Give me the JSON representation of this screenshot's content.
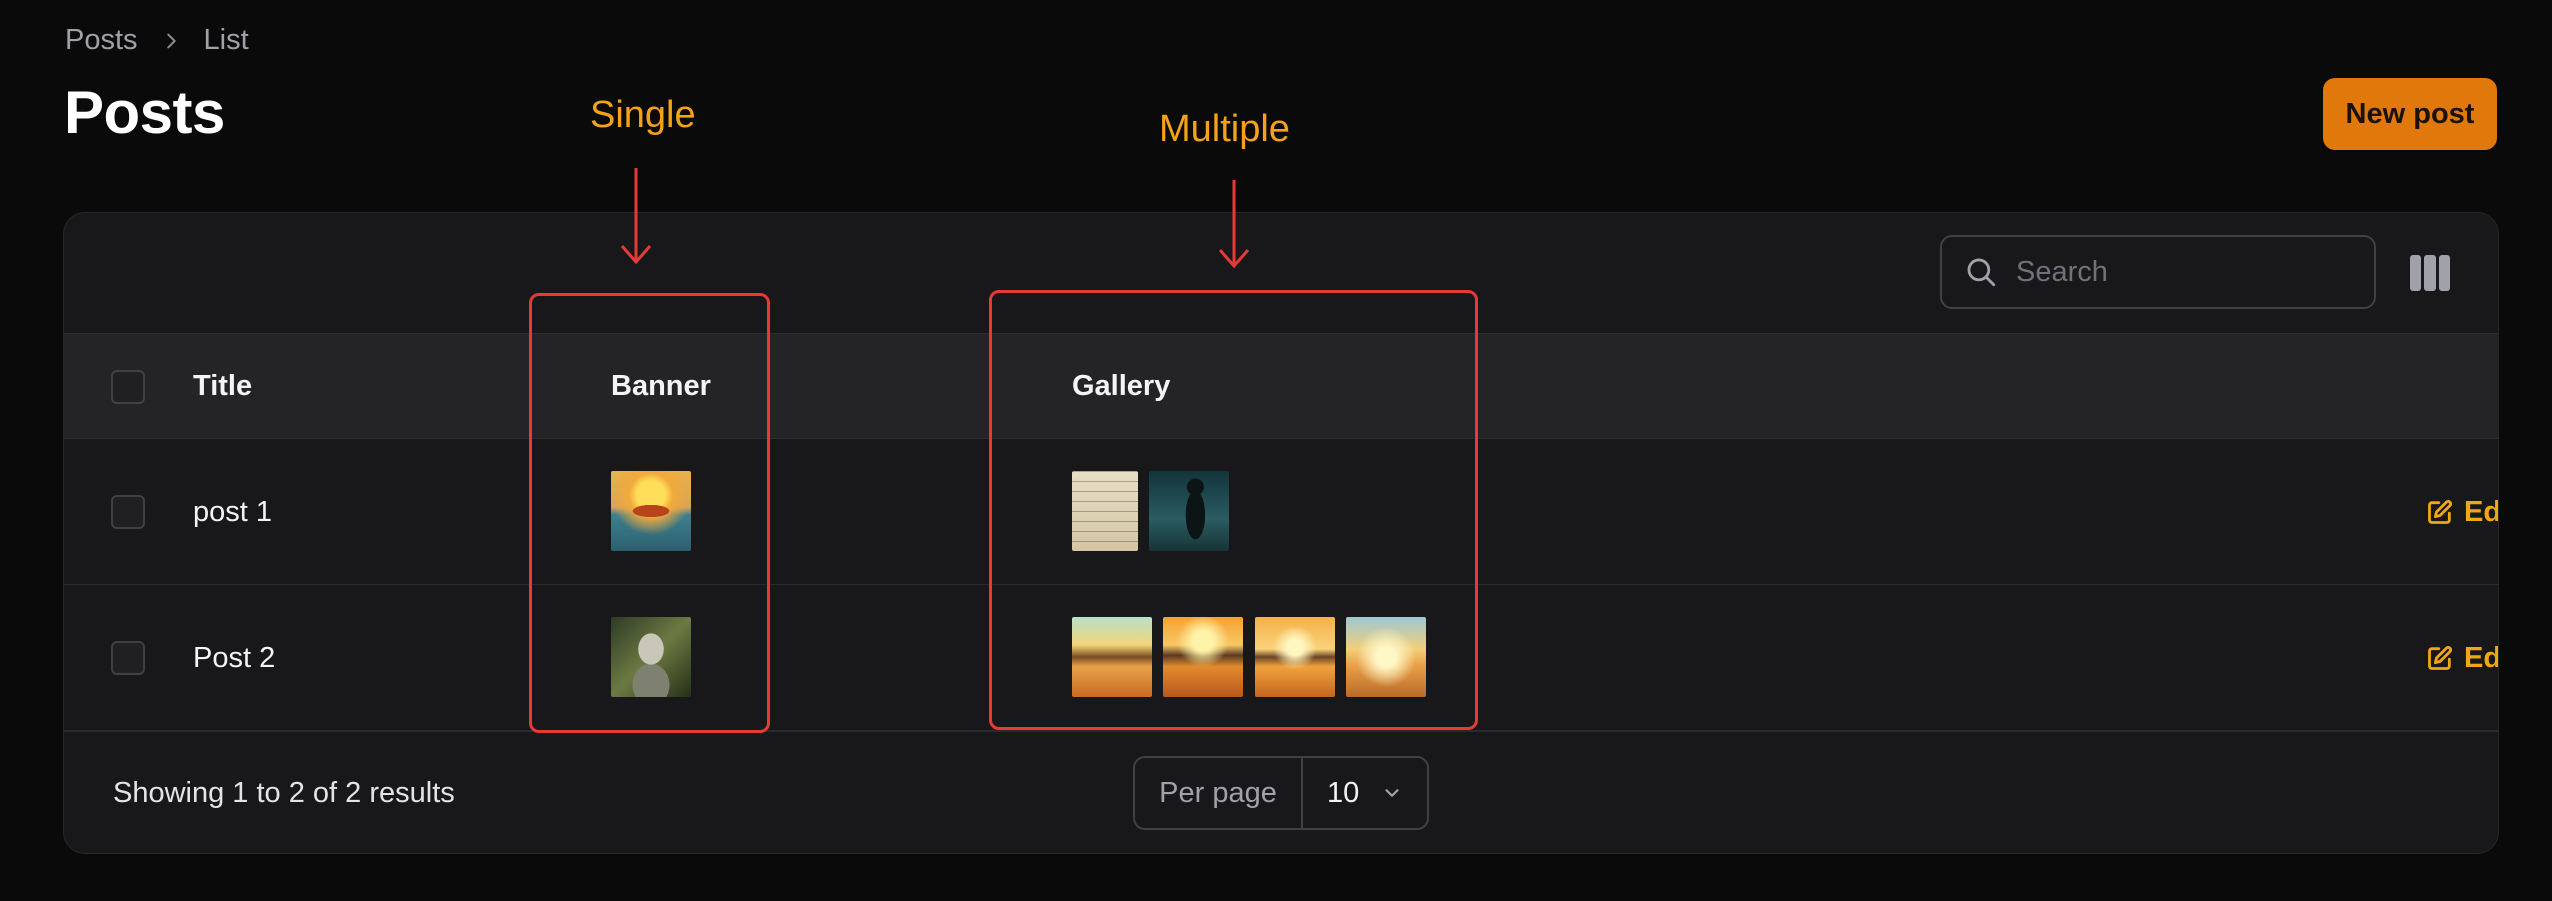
{
  "breadcrumb": {
    "items": [
      "Posts",
      "List"
    ]
  },
  "page": {
    "title": "Posts"
  },
  "actions": {
    "new_post_label": "New post"
  },
  "search": {
    "placeholder": "Search",
    "value": ""
  },
  "table": {
    "columns": [
      "Title",
      "Banner",
      "Gallery"
    ],
    "rows": [
      {
        "title": "post 1",
        "banner": "mushroom-landscape-image",
        "gallery": [
          "sketch-paper-image",
          "girl-silhouette-image"
        ],
        "action_label": "Edit"
      },
      {
        "title": "Post 2",
        "banner": "robot-image",
        "gallery": [
          "sunset-gas-station-image-1",
          "sunset-gas-station-image-2",
          "sunset-gas-station-image-3",
          "sunset-gas-station-image-4"
        ],
        "action_label": "Edit"
      }
    ]
  },
  "footer": {
    "results_text": "Showing 1 to 2 of 2 results",
    "per_page_label": "Per page",
    "per_page_value": "10"
  },
  "annotations": {
    "single_label": "Single",
    "multiple_label": "Multiple",
    "color": "#e53a36",
    "label_color": "#f4a21a"
  },
  "colors": {
    "background": "#0a0a0a",
    "card": "#18181b",
    "accent": "#e0780c",
    "link": "#f0a812"
  }
}
